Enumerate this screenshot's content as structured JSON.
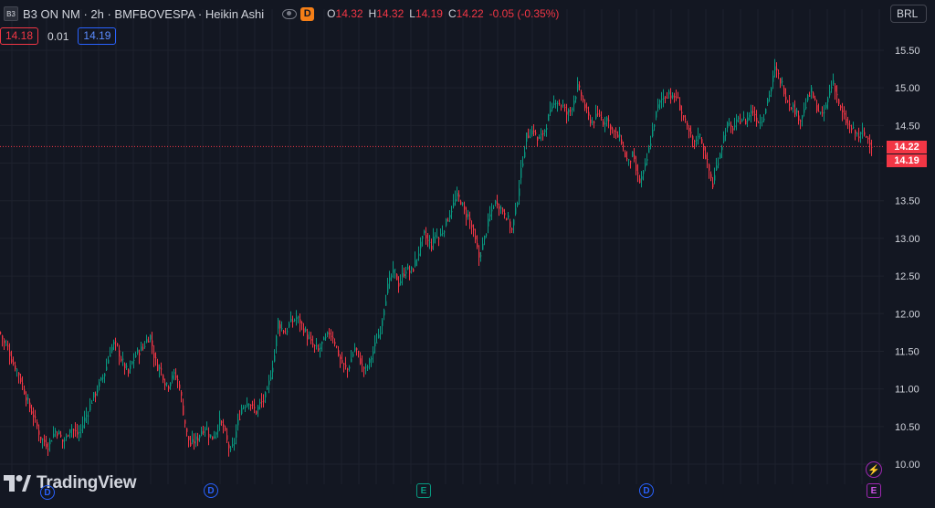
{
  "legend": {
    "symbol_logo": "B3",
    "title": "B3 ON NM · 2h · BMFBOVESPA · Heikin Ashi",
    "interval_badge": "D",
    "ohlc": [
      {
        "key": "O",
        "value": "14.32"
      },
      {
        "key": "H",
        "value": "14.32"
      },
      {
        "key": "L",
        "value": "14.19"
      },
      {
        "key": "C",
        "value": "14.22"
      }
    ],
    "change": "-0.05 (-0.35%)"
  },
  "quote": {
    "bid": "14.18",
    "spread": "0.01",
    "ask": "14.19"
  },
  "currency": "BRL",
  "price_tags": [
    "14.22",
    "14.19"
  ],
  "branding": {
    "name": "TradingView"
  },
  "events": [
    {
      "label": "D",
      "kind": "dividend"
    },
    {
      "label": "D",
      "kind": "dividend"
    },
    {
      "label": "E",
      "kind": "earnings"
    },
    {
      "label": "D",
      "kind": "dividend"
    },
    {
      "label": "E",
      "kind": "earnings-upcoming"
    }
  ],
  "colors": {
    "background": "#131722",
    "up": "#089981",
    "down": "#f23645",
    "grid": "#1e222d",
    "text": "#d1d4dc"
  },
  "chart_data": {
    "type": "candlestick",
    "style": "Heikin Ashi",
    "ylim": [
      9.9,
      15.7
    ],
    "yticks": [
      "10.00",
      "10.50",
      "11.00",
      "11.50",
      "12.00",
      "12.50",
      "13.00",
      "13.50",
      "14.00",
      "14.50",
      "15.00",
      "15.50"
    ],
    "last_price": 14.22,
    "grid": true,
    "close_path": [
      [
        0,
        11.75
      ],
      [
        4,
        11.6
      ],
      [
        8,
        11.55
      ],
      [
        12,
        11.4
      ],
      [
        16,
        11.3
      ],
      [
        20,
        11.2
      ],
      [
        24,
        11.05
      ],
      [
        28,
        10.9
      ],
      [
        32,
        10.75
      ],
      [
        36,
        10.65
      ],
      [
        40,
        10.5
      ],
      [
        44,
        10.35
      ],
      [
        48,
        10.3
      ],
      [
        52,
        10.25
      ],
      [
        56,
        10.35
      ],
      [
        60,
        10.45
      ],
      [
        64,
        10.4
      ],
      [
        68,
        10.3
      ],
      [
        72,
        10.35
      ],
      [
        76,
        10.5
      ],
      [
        80,
        10.45
      ],
      [
        84,
        10.4
      ],
      [
        88,
        10.45
      ],
      [
        92,
        10.6
      ],
      [
        96,
        10.7
      ],
      [
        100,
        10.85
      ],
      [
        104,
        10.95
      ],
      [
        108,
        11.05
      ],
      [
        112,
        11.15
      ],
      [
        116,
        11.3
      ],
      [
        120,
        11.5
      ],
      [
        124,
        11.6
      ],
      [
        128,
        11.55
      ],
      [
        132,
        11.4
      ],
      [
        136,
        11.3
      ],
      [
        140,
        11.2
      ],
      [
        144,
        11.35
      ],
      [
        148,
        11.45
      ],
      [
        152,
        11.5
      ],
      [
        156,
        11.55
      ],
      [
        160,
        11.65
      ],
      [
        164,
        11.7
      ],
      [
        168,
        11.45
      ],
      [
        172,
        11.3
      ],
      [
        176,
        11.25
      ],
      [
        180,
        11.1
      ],
      [
        184,
        11.05
      ],
      [
        188,
        11.2
      ],
      [
        192,
        11.15
      ],
      [
        196,
        11.05
      ],
      [
        200,
        10.7
      ],
      [
        204,
        10.4
      ],
      [
        208,
        10.25
      ],
      [
        212,
        10.3
      ],
      [
        216,
        10.35
      ],
      [
        220,
        10.45
      ],
      [
        224,
        10.5
      ],
      [
        228,
        10.4
      ],
      [
        232,
        10.35
      ],
      [
        236,
        10.45
      ],
      [
        240,
        10.55
      ],
      [
        244,
        10.5
      ],
      [
        248,
        10.3
      ],
      [
        252,
        10.15
      ],
      [
        256,
        10.3
      ],
      [
        260,
        10.55
      ],
      [
        264,
        10.75
      ],
      [
        268,
        10.8
      ],
      [
        272,
        10.85
      ],
      [
        276,
        10.75
      ],
      [
        280,
        10.7
      ],
      [
        284,
        10.8
      ],
      [
        288,
        10.85
      ],
      [
        292,
        10.95
      ],
      [
        296,
        11.2
      ],
      [
        300,
        11.45
      ],
      [
        304,
        11.9
      ],
      [
        308,
        11.8
      ],
      [
        312,
        11.75
      ],
      [
        316,
        11.85
      ],
      [
        320,
        11.9
      ],
      [
        324,
        11.95
      ],
      [
        328,
        11.9
      ],
      [
        332,
        11.8
      ],
      [
        336,
        11.7
      ],
      [
        340,
        11.6
      ],
      [
        344,
        11.55
      ],
      [
        348,
        11.5
      ],
      [
        352,
        11.6
      ],
      [
        356,
        11.65
      ],
      [
        360,
        11.75
      ],
      [
        364,
        11.7
      ],
      [
        368,
        11.55
      ],
      [
        372,
        11.4
      ],
      [
        376,
        11.3
      ],
      [
        380,
        11.25
      ],
      [
        384,
        11.4
      ],
      [
        388,
        11.55
      ],
      [
        392,
        11.45
      ],
      [
        396,
        11.3
      ],
      [
        400,
        11.25
      ],
      [
        404,
        11.35
      ],
      [
        408,
        11.5
      ],
      [
        412,
        11.65
      ],
      [
        416,
        11.8
      ],
      [
        420,
        12.1
      ],
      [
        424,
        12.35
      ],
      [
        428,
        12.5
      ],
      [
        432,
        12.55
      ],
      [
        436,
        12.4
      ],
      [
        440,
        12.5
      ],
      [
        444,
        12.6
      ],
      [
        448,
        12.55
      ],
      [
        452,
        12.6
      ],
      [
        456,
        12.75
      ],
      [
        460,
        12.9
      ],
      [
        464,
        13.05
      ],
      [
        468,
        12.95
      ],
      [
        472,
        12.9
      ],
      [
        476,
        13.05
      ],
      [
        480,
        13.0
      ],
      [
        484,
        13.1
      ],
      [
        488,
        13.2
      ],
      [
        492,
        13.35
      ],
      [
        496,
        13.45
      ],
      [
        500,
        13.55
      ],
      [
        504,
        13.5
      ],
      [
        508,
        13.35
      ],
      [
        512,
        13.3
      ],
      [
        516,
        13.15
      ],
      [
        520,
        12.95
      ],
      [
        524,
        12.75
      ],
      [
        528,
        12.9
      ],
      [
        532,
        13.1
      ],
      [
        536,
        13.3
      ],
      [
        540,
        13.45
      ],
      [
        544,
        13.5
      ],
      [
        548,
        13.4
      ],
      [
        552,
        13.35
      ],
      [
        556,
        13.25
      ],
      [
        560,
        13.1
      ],
      [
        564,
        13.35
      ],
      [
        568,
        13.7
      ],
      [
        572,
        14.05
      ],
      [
        576,
        14.35
      ],
      [
        580,
        14.4
      ],
      [
        584,
        14.45
      ],
      [
        588,
        14.3
      ],
      [
        592,
        14.35
      ],
      [
        596,
        14.45
      ],
      [
        600,
        14.6
      ],
      [
        604,
        14.7
      ],
      [
        608,
        14.85
      ],
      [
        612,
        14.8
      ],
      [
        616,
        14.75
      ],
      [
        620,
        14.65
      ],
      [
        624,
        14.7
      ],
      [
        628,
        14.85
      ],
      [
        632,
        15.0
      ],
      [
        636,
        14.9
      ],
      [
        640,
        14.75
      ],
      [
        644,
        14.6
      ],
      [
        648,
        14.55
      ],
      [
        652,
        14.6
      ],
      [
        656,
        14.65
      ],
      [
        660,
        14.55
      ],
      [
        664,
        14.6
      ],
      [
        668,
        14.5
      ],
      [
        672,
        14.4
      ],
      [
        676,
        14.35
      ],
      [
        680,
        14.3
      ],
      [
        684,
        14.1
      ],
      [
        688,
        14.0
      ],
      [
        692,
        14.1
      ],
      [
        696,
        13.9
      ],
      [
        700,
        13.75
      ],
      [
        704,
        13.85
      ],
      [
        708,
        14.05
      ],
      [
        712,
        14.3
      ],
      [
        716,
        14.55
      ],
      [
        720,
        14.75
      ],
      [
        724,
        14.85
      ],
      [
        728,
        14.9
      ],
      [
        732,
        14.95
      ],
      [
        736,
        14.85
      ],
      [
        740,
        14.9
      ],
      [
        744,
        14.75
      ],
      [
        748,
        14.6
      ],
      [
        752,
        14.45
      ],
      [
        756,
        14.35
      ],
      [
        760,
        14.25
      ],
      [
        764,
        14.4
      ],
      [
        768,
        14.3
      ],
      [
        772,
        14.1
      ],
      [
        776,
        13.9
      ],
      [
        780,
        13.7
      ],
      [
        784,
        13.95
      ],
      [
        788,
        14.15
      ],
      [
        792,
        14.35
      ],
      [
        796,
        14.5
      ],
      [
        800,
        14.45
      ],
      [
        804,
        14.5
      ],
      [
        808,
        14.55
      ],
      [
        812,
        14.6
      ],
      [
        816,
        14.55
      ],
      [
        820,
        14.65
      ],
      [
        824,
        14.7
      ],
      [
        828,
        14.6
      ],
      [
        832,
        14.55
      ],
      [
        836,
        14.65
      ],
      [
        840,
        14.85
      ],
      [
        844,
        15.0
      ],
      [
        848,
        15.25
      ],
      [
        852,
        15.15
      ],
      [
        856,
        15.05
      ],
      [
        860,
        14.9
      ],
      [
        864,
        14.8
      ],
      [
        868,
        14.75
      ],
      [
        872,
        14.65
      ],
      [
        876,
        14.6
      ],
      [
        880,
        14.7
      ],
      [
        884,
        14.85
      ],
      [
        888,
        14.95
      ],
      [
        892,
        14.8
      ],
      [
        896,
        14.7
      ],
      [
        900,
        14.6
      ],
      [
        904,
        14.75
      ],
      [
        908,
        14.95
      ],
      [
        912,
        15.1
      ],
      [
        916,
        14.9
      ],
      [
        920,
        14.7
      ],
      [
        924,
        14.6
      ],
      [
        928,
        14.5
      ],
      [
        932,
        14.45
      ],
      [
        936,
        14.4
      ],
      [
        940,
        14.35
      ],
      [
        944,
        14.4
      ],
      [
        948,
        14.35
      ],
      [
        952,
        14.3
      ],
      [
        955,
        14.22
      ]
    ]
  }
}
